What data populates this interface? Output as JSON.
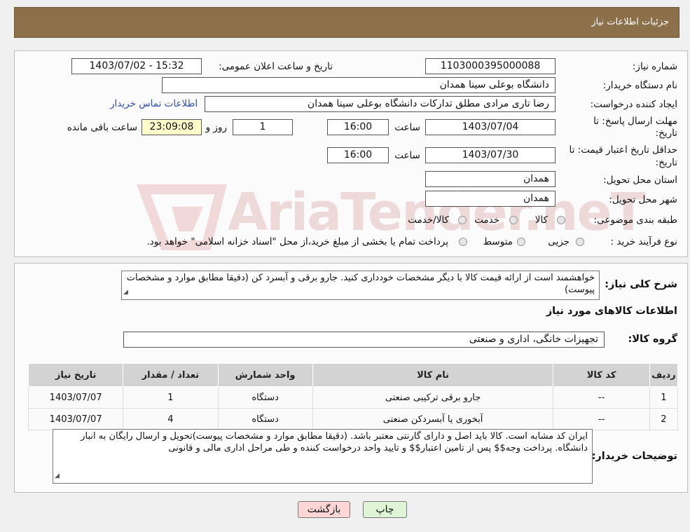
{
  "header": {
    "title": "جزئیات اطلاعات نیاز"
  },
  "watermark": {
    "text": "AriaTender.neT"
  },
  "form": {
    "need_number_label": "شماره نیاز:",
    "need_number": "1103000395000088",
    "announce_label": "تاریخ و ساعت اعلان عمومی:",
    "announce_value": "1403/07/02 - 15:32",
    "buyer_org_label": "نام دستگاه خریدار:",
    "buyer_org": "دانشگاه بوعلی سینا همدان",
    "requester_label": "ایجاد کننده درخواست:",
    "requester": "رضا تاری مرادی مطلق تدارکات دانشگاه بوعلی سینا همدان",
    "contact_link": "اطلاعات تماس خریدار",
    "reply_deadline_label_1": "مهلت ارسال پاسخ: تا",
    "reply_deadline_label_2": "تاریخ:",
    "reply_date": "1403/07/04",
    "time_label": "ساعت",
    "reply_time": "16:00",
    "days": "1",
    "days_label": "روز و",
    "remaining_time": "23:09:08",
    "remaining_label": "ساعت باقی مانده",
    "price_validity_label_1": "حداقل تاریخ اعتبار قیمت: تا",
    "price_validity_label_2": "تاریخ:",
    "price_validity_date": "1403/07/30",
    "price_validity_time": "16:00",
    "province_label": "استان محل تحویل:",
    "province": "همدان",
    "city_label": "شهر محل تحویل:",
    "city": "همدان",
    "category_label": "طبقه بندی موضوعی:",
    "category_options": [
      "کالا",
      "خدمت",
      "کالا/خدمت"
    ],
    "process_label": "نوع فرآیند خرید :",
    "process_options": [
      "جزیی",
      "متوسط"
    ],
    "process_note": "پرداخت تمام یا بخشی از مبلغ خرید،از محل \"اسناد خزانه اسلامی\" خواهد بود."
  },
  "description": {
    "label": "شرح کلی نیاز:",
    "text": "خواهشمند است از ارائه قیمت کالا با دیگر مشخصات خودداری کنید.  جارو برقی و آبسرد کن   (دقیقا مطابق موارد و مشخصات پیوست)"
  },
  "goods_section_title": "اطلاعات کالاهای مورد نیاز",
  "goods_group": {
    "label": "گروه کالا:",
    "value": "تجهیزات خانگی، اداری و صنعتی"
  },
  "table": {
    "headers": [
      "ردیف",
      "کد کالا",
      "نام کالا",
      "واحد شمارش",
      "تعداد / مقدار",
      "تاریخ نیاز"
    ],
    "rows": [
      [
        "1",
        "--",
        "جارو برقی ترکیبی صنعتی",
        "دستگاه",
        "1",
        "1403/07/07"
      ],
      [
        "2",
        "--",
        "آبخوری یا آبسردکن صنعتی",
        "دستگاه",
        "4",
        "1403/07/07"
      ]
    ]
  },
  "buyer_notes": {
    "label": "توضیحات خریدار:",
    "text": "ایران کد مشابه است. کالا باید اصل و دارای گارنتی معتبر باشد. (دقیقا مطابق موارد و مشخصات پیوست)تحویل و ارسال رایگان به انبار دانشگاه. پرداخت وجه$$ پس از تامین اعتبار$$ و تایید واحد درخواست کننده و طی مراحل اداری مالی و قانونی"
  },
  "buttons": {
    "print": "چاپ",
    "back": "بازگشت"
  },
  "colors": {
    "header_bg": "#8b7049",
    "back_button_bg": "#ffd6d6",
    "print_button_bg": "#dff5d5",
    "link": "#2d4fa8"
  }
}
